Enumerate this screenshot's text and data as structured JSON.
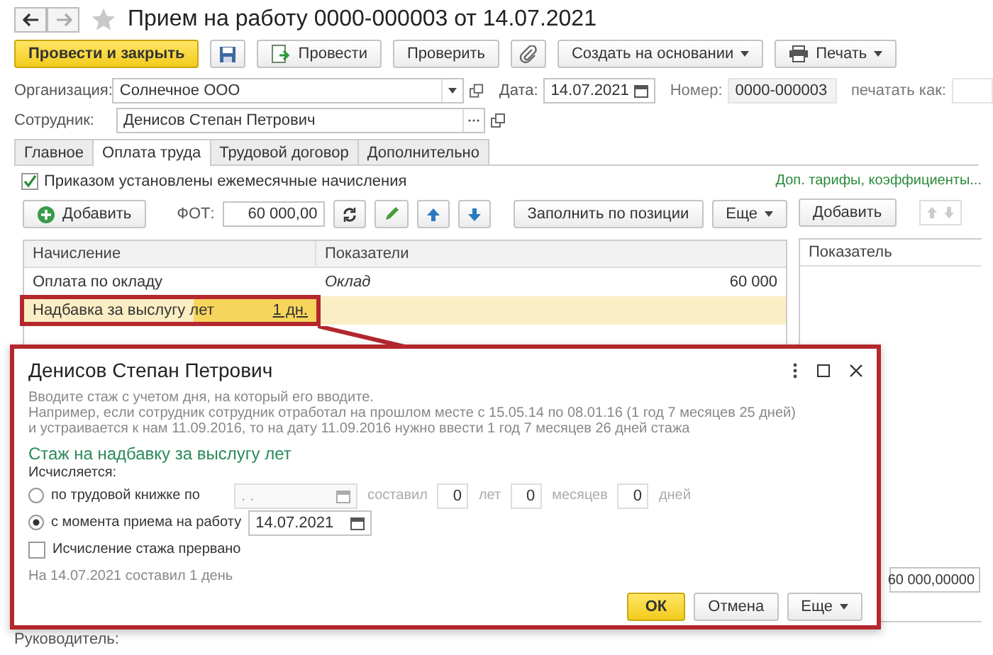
{
  "window": {
    "title": "Прием на работу 0000-000003 от 14.07.2021"
  },
  "toolbar": {
    "post_close": "Провести и закрыть",
    "post": "Провести",
    "check": "Проверить",
    "create_based": "Создать на основании",
    "print": "Печать"
  },
  "header": {
    "organization": {
      "label": "Организация:",
      "value": "Солнечное ООО"
    },
    "date": {
      "label": "Дата:",
      "value": "14.07.2021"
    },
    "number": {
      "label": "Номер:",
      "value": "0000-000003"
    },
    "print_as": {
      "label": "печатать как:"
    },
    "employee": {
      "label": "Сотрудник:",
      "value": "Денисов Степан Петрович"
    }
  },
  "tabs": [
    {
      "label": "Главное",
      "selected": false
    },
    {
      "label": "Оплата труда",
      "selected": true
    },
    {
      "label": "Трудовой договор",
      "selected": false
    },
    {
      "label": "Дополнительно",
      "selected": false
    }
  ],
  "pay": {
    "monthly_checkbox": {
      "label": "Приказом установлены ежемесячные начисления",
      "checked": true
    },
    "extra_link": "Доп. тарифы, коэффициенты...",
    "add_button": "Добавить",
    "fot_label": "ФОТ:",
    "fot_value": "60 000,00",
    "fill_button": "Заполнить по позиции",
    "more_button": "Еще",
    "table": {
      "columns": [
        "Начисление",
        "Показатели"
      ],
      "rows": [
        {
          "accrual": "Оплата по окладу",
          "value": "",
          "indicator": "Оклад",
          "amount": "60 000",
          "selected": false
        },
        {
          "accrual": "Надбавка за выслугу лет",
          "value": "1 дн.",
          "indicator": "",
          "amount": "",
          "selected": true
        }
      ]
    },
    "right_panel": {
      "add_button": "Добавить",
      "column": "Показатель",
      "field_value": "60 000,00000"
    },
    "manager_label": "Руководитель:"
  },
  "dialog": {
    "title": "Денисов Степан Петрович",
    "hint_lines": [
      "Вводите стаж с учетом дня, на который его вводите.",
      "Например, если сотрудник сотрудник отработал на прошлом месте с 15.05.14 по 08.01.16 (1 год 7 месяцев 25 дней)",
      "и устраивается к нам 11.09.2016, то на дату 11.09.2016 нужно ввести 1 год 7 месяцев 26 дней стажа"
    ],
    "section_title": "Стаж на надбавку за выслугу лет",
    "calc_label": "Исчисляется:",
    "options": [
      {
        "kind": "book",
        "label": "по трудовой книжке по",
        "selected": false,
        "date_placeholder": ". .",
        "composed": "составил",
        "years": "0",
        "years_unit": "лет",
        "months": "0",
        "months_unit": "месяцев",
        "days": "0",
        "days_unit": "дней"
      },
      {
        "kind": "hire",
        "label": "с момента приема на работу",
        "selected": true,
        "date": "14.07.2021"
      }
    ],
    "interrupted": {
      "label": "Исчисление стажа прервано",
      "checked": false
    },
    "summary": "На 14.07.2021 составил 1 день",
    "buttons": {
      "ok": "ОК",
      "cancel": "Отмена",
      "more": "Еще"
    }
  }
}
